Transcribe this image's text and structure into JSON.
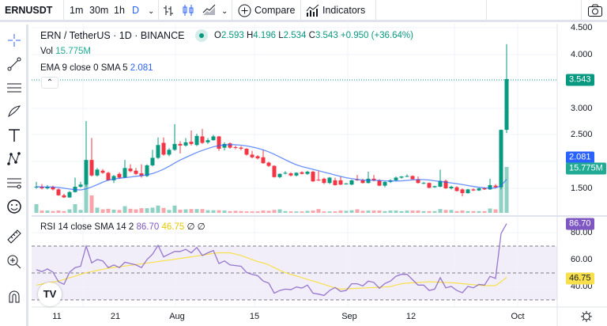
{
  "toolbar": {
    "symbol": "ERNUSDT",
    "intervals": [
      "1m",
      "30m",
      "1h",
      "D"
    ],
    "active_interval": "D",
    "compare": "Compare",
    "indicators": "Indicators"
  },
  "legend": {
    "title": "ERN / TetherUS · 1D · BINANCE",
    "o_label": "O",
    "o": "2.593",
    "h_label": "H",
    "h": "4.196",
    "l_label": "L",
    "l": "2.534",
    "c_label": "C",
    "c": "3.543",
    "change": "+0.950 (+36.64%)",
    "vol_label": "Vol",
    "vol": "15.775M",
    "ema_label": "EMA 9 close 0 SMA 5",
    "ema": "2.081",
    "rsi_label": "RSI 14 close SMA 14 2",
    "rsi": "86.70",
    "rsi_sma": "46.75",
    "rsi_extra": "∅ ∅"
  },
  "price_axis": {
    "ticks": [
      "4.500",
      "4.000",
      "3.000",
      "2.500",
      "1.500"
    ],
    "last_price": "3.543",
    "ema_value": "2.081",
    "volume_value": "15.775M"
  },
  "rsi_axis": {
    "ticks": [
      "80.00",
      "60.00",
      "40.00"
    ],
    "rsi_value": "86.70",
    "sma_value": "46.75"
  },
  "time_axis": {
    "ticks": [
      "11",
      "21",
      "Aug",
      "15",
      "Sep",
      "12",
      "Oct"
    ]
  },
  "colors": {
    "up": "#089981",
    "down": "#f23645",
    "ema": "#2962ff",
    "rsi": "#7e57c2",
    "rsi_sma": "#f7e04b",
    "accent": "#2962ff"
  },
  "chart_data": {
    "type": "candlestick",
    "ohlc": [
      [
        1.52,
        1.62,
        1.49,
        1.53
      ],
      [
        1.53,
        1.58,
        1.48,
        1.5
      ],
      [
        1.5,
        1.56,
        1.48,
        1.53
      ],
      [
        1.53,
        1.55,
        1.46,
        1.48
      ],
      [
        1.48,
        1.5,
        1.36,
        1.37
      ],
      [
        1.37,
        1.4,
        1.32,
        1.33
      ],
      [
        1.33,
        1.45,
        1.32,
        1.43
      ],
      [
        1.43,
        1.7,
        1.42,
        1.53
      ],
      [
        1.53,
        1.62,
        1.51,
        1.57
      ],
      [
        1.57,
        2.76,
        1.53,
        2.03
      ],
      [
        2.03,
        2.44,
        1.72,
        1.74
      ],
      [
        1.74,
        1.88,
        1.72,
        1.85
      ],
      [
        1.83,
        1.86,
        1.77,
        1.79
      ],
      [
        1.79,
        1.81,
        1.64,
        1.65
      ],
      [
        1.65,
        1.75,
        1.6,
        1.73
      ],
      [
        1.77,
        1.8,
        1.68,
        1.7
      ],
      [
        1.7,
        2.03,
        1.69,
        1.88
      ],
      [
        1.87,
        1.95,
        1.8,
        1.82
      ],
      [
        1.83,
        1.88,
        1.75,
        1.77
      ],
      [
        1.78,
        1.95,
        1.7,
        1.73
      ],
      [
        1.73,
        1.95,
        1.71,
        1.93
      ],
      [
        1.93,
        2.22,
        1.91,
        2.07
      ],
      [
        2.07,
        2.45,
        2.05,
        2.31
      ],
      [
        2.35,
        2.45,
        2.11,
        2.13
      ],
      [
        2.13,
        2.25,
        2.1,
        2.22
      ],
      [
        2.22,
        2.7,
        2.2,
        2.33
      ],
      [
        2.33,
        2.38,
        2.15,
        2.3
      ],
      [
        2.3,
        2.44,
        2.28,
        2.36
      ],
      [
        2.37,
        2.58,
        2.3,
        2.33
      ],
      [
        2.31,
        2.52,
        2.29,
        2.48
      ],
      [
        2.47,
        2.61,
        2.33,
        2.35
      ],
      [
        2.36,
        2.44,
        2.33,
        2.4
      ],
      [
        2.4,
        2.5,
        2.39,
        2.47
      ],
      [
        2.47,
        2.48,
        2.2,
        2.24
      ],
      [
        2.26,
        2.36,
        2.21,
        2.33
      ],
      [
        2.34,
        2.36,
        2.24,
        2.26
      ],
      [
        2.27,
        2.3,
        2.23,
        2.26
      ],
      [
        2.26,
        2.29,
        2.21,
        2.24
      ],
      [
        2.24,
        2.25,
        2.11,
        2.13
      ],
      [
        2.13,
        2.2,
        2.06,
        2.08
      ],
      [
        2.1,
        2.12,
        2.04,
        2.06
      ],
      [
        2.08,
        2.22,
        1.96,
        1.97
      ],
      [
        1.98,
        2.0,
        1.9,
        1.92
      ],
      [
        1.92,
        1.93,
        1.7,
        1.71
      ],
      [
        1.71,
        1.78,
        1.69,
        1.77
      ],
      [
        1.78,
        1.82,
        1.76,
        1.79
      ],
      [
        1.78,
        1.8,
        1.72,
        1.74
      ],
      [
        1.74,
        1.8,
        1.72,
        1.79
      ],
      [
        1.8,
        1.82,
        1.76,
        1.77
      ],
      [
        1.77,
        1.83,
        1.75,
        1.81
      ],
      [
        1.81,
        1.83,
        1.62,
        1.63
      ],
      [
        1.66,
        1.82,
        1.64,
        1.65
      ],
      [
        1.68,
        1.7,
        1.58,
        1.6
      ],
      [
        1.6,
        1.71,
        1.58,
        1.7
      ],
      [
        1.65,
        1.7,
        1.55,
        1.56
      ],
      [
        1.65,
        1.72,
        1.56,
        1.57
      ],
      [
        1.58,
        1.6,
        1.57,
        1.59
      ],
      [
        1.57,
        1.66,
        1.56,
        1.65
      ],
      [
        1.67,
        1.75,
        1.64,
        1.65
      ],
      [
        1.65,
        1.68,
        1.59,
        1.6
      ],
      [
        1.6,
        1.81,
        1.59,
        1.68
      ],
      [
        1.68,
        1.75,
        1.63,
        1.65
      ],
      [
        1.65,
        1.67,
        1.54,
        1.55
      ],
      [
        1.55,
        1.63,
        1.52,
        1.62
      ],
      [
        1.62,
        1.67,
        1.6,
        1.65
      ],
      [
        1.65,
        1.72,
        1.63,
        1.7
      ],
      [
        1.7,
        1.73,
        1.68,
        1.72
      ],
      [
        1.72,
        1.76,
        1.71,
        1.73
      ],
      [
        1.73,
        1.74,
        1.66,
        1.67
      ],
      [
        1.67,
        1.72,
        1.59,
        1.6
      ],
      [
        1.6,
        1.62,
        1.58,
        1.6
      ],
      [
        1.6,
        1.61,
        1.5,
        1.51
      ],
      [
        1.52,
        1.55,
        1.51,
        1.54
      ],
      [
        1.53,
        1.85,
        1.52,
        1.64
      ],
      [
        1.64,
        1.66,
        1.49,
        1.5
      ],
      [
        1.5,
        1.55,
        1.48,
        1.53
      ],
      [
        1.52,
        1.54,
        1.44,
        1.45
      ],
      [
        1.48,
        1.5,
        1.35,
        1.41
      ],
      [
        1.41,
        1.49,
        1.4,
        1.48
      ],
      [
        1.48,
        1.5,
        1.45,
        1.46
      ],
      [
        1.46,
        1.51,
        1.45,
        1.5
      ],
      [
        1.5,
        1.52,
        1.47,
        1.48
      ],
      [
        1.48,
        1.68,
        1.47,
        1.56
      ],
      [
        1.55,
        1.58,
        1.51,
        1.52
      ],
      [
        1.52,
        2.6,
        1.48,
        2.593
      ],
      [
        2.593,
        4.196,
        2.534,
        3.543
      ]
    ],
    "volume_m": [
      3.0,
      0.8,
      0.8,
      0.6,
      0.8,
      0.6,
      1.2,
      3.0,
      1.0,
      10,
      6.0,
      1.8,
      1.2,
      1.4,
      1.1,
      1.0,
      2.3,
      1.4,
      1.2,
      1.6,
      1.6,
      1.8,
      2.5,
      1.7,
      1.0,
      2.5,
      1.1,
      1.2,
      1.3,
      1.3,
      1.3,
      0.9,
      0.9,
      0.9,
      0.8,
      0.6,
      0.7,
      0.6,
      0.5,
      0.5,
      0.5,
      0.8,
      0.7,
      1.0,
      1.2,
      0.6,
      0.5,
      0.5,
      0.5,
      0.7,
      0.8,
      1.3,
      0.5,
      0.5,
      0.5,
      0.8,
      0.7,
      0.9,
      1.2,
      0.7,
      0.8,
      0.8,
      0.8,
      0.6,
      0.8,
      0.8,
      0.6,
      0.8,
      0.8,
      0.8,
      0.6,
      0.6,
      0.6,
      1.3,
      1.0,
      1.0,
      0.6,
      0.8,
      0.6,
      0.6,
      0.6,
      0.6,
      1.5,
      1.2,
      10.5,
      15.775
    ],
    "rsi": [
      52.4,
      51,
      53,
      50.6,
      43.5,
      41.6,
      50.6,
      54,
      55,
      70,
      57.5,
      60,
      59,
      54,
      56,
      54,
      58,
      57,
      56,
      54,
      60,
      64,
      70.6,
      62,
      64,
      66,
      66,
      67.6,
      65,
      69,
      63,
      65,
      66.7,
      57,
      59,
      56,
      55.5,
      55,
      50.4,
      49,
      48,
      44,
      42.5,
      35,
      37,
      38,
      37.6,
      39.6,
      38.8,
      41,
      35,
      34.3,
      33.3,
      37,
      39.2,
      36.3,
      37,
      42,
      42,
      40.4,
      44,
      43,
      38.6,
      42.2,
      44,
      47.6,
      49,
      49,
      45,
      41,
      41,
      37,
      38,
      46.5,
      39,
      40,
      37,
      35.3,
      40,
      39,
      41.5,
      41,
      47.5,
      46,
      79.4,
      86.7
    ],
    "rsi_sma": [
      41,
      41.7,
      42.5,
      43.2,
      44,
      45.2,
      46.5,
      47.7,
      49,
      50.2,
      51,
      51.9,
      52.7,
      53.6,
      54.1,
      54.6,
      55.2,
      55.7,
      56.3,
      56.8,
      57.4,
      57.9,
      58.5,
      59.1,
      59.6,
      60.2,
      60.8,
      61.4,
      62,
      62.6,
      63.3,
      63.9,
      64.6,
      65,
      65,
      65,
      64,
      63,
      61.5,
      60,
      58.5,
      57.5,
      56,
      54,
      52,
      50.2,
      49,
      47.8,
      46.5,
      45.2,
      44,
      42.8,
      41.5,
      40.2,
      39,
      38,
      38.2,
      38.4,
      38.6,
      38.8,
      39,
      39.2,
      39.4,
      39.6,
      39.9,
      41,
      42,
      42.5,
      42.7,
      43,
      43.2,
      43.5,
      43.3,
      43.1,
      42.9,
      42.7,
      42.5,
      42.1,
      41.7,
      41.3,
      41,
      40.6,
      40.6,
      40.6,
      43.5,
      46.75
    ],
    "ema_period": 9,
    "ema_smoothing": 5,
    "price_range": [
      1.1,
      4.5
    ],
    "rsi_bands": [
      30,
      50,
      70
    ],
    "grid": true
  }
}
